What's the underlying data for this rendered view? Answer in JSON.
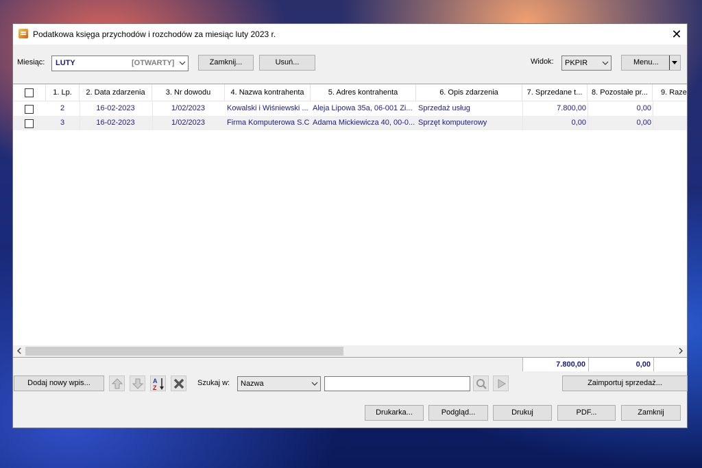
{
  "window": {
    "title": "Podatkowa księga przychodów i rozchodów za miesiąc luty 2023 r.",
    "close_glyph": "✕"
  },
  "toolbar": {
    "month_label": "Miesiąc:",
    "month_value": "LUTY",
    "month_status": "[OTWARTY]",
    "close_month_button": "Zamknij...",
    "delete_button": "Usuń...",
    "view_label": "Widok:",
    "view_value": "PKPIR",
    "menu_button": "Menu..."
  },
  "grid": {
    "columns": [
      "1. Lp.",
      "2. Data zdarzenia",
      "3. Nr dowodu",
      "4. Nazwa kontrahenta",
      "5. Adres kontrahenta",
      "6. Opis zdarzenia",
      "7. Sprzedane t...",
      "8. Pozostałe pr...",
      "9. Raze"
    ],
    "rows": [
      {
        "lp": "2",
        "date": "16-02-2023",
        "doc": "1/02/2023",
        "name": "Kowalski i Wiśniewski ...",
        "address": "Aleja Lipowa 35a,  06-001 Zi...",
        "desc": "Sprzedaż usług",
        "sold": "7.800,00",
        "other": "0,00"
      },
      {
        "lp": "3",
        "date": "16-02-2023",
        "doc": "1/02/2023",
        "name": "Firma Komputerowa S.C.",
        "address": "Adama Mickiewicza 40, 00-0...",
        "desc": "Sprzęt komputerowy",
        "sold": "0,00",
        "other": "0,00"
      }
    ],
    "totals": {
      "sold": "7.800,00",
      "other": "0,00"
    }
  },
  "bottom_bar": {
    "add_button": "Dodaj nowy wpis...",
    "search_label": "Szukaj w:",
    "search_field": "Nazwa",
    "search_value": "",
    "import_button": "Zaimportuj sprzedaż..."
  },
  "footer": {
    "printer_button": "Drukarka...",
    "preview_button": "Podgląd...",
    "print_button": "Drukuj",
    "pdf_button": "PDF...",
    "close_button": "Zamknij"
  }
}
